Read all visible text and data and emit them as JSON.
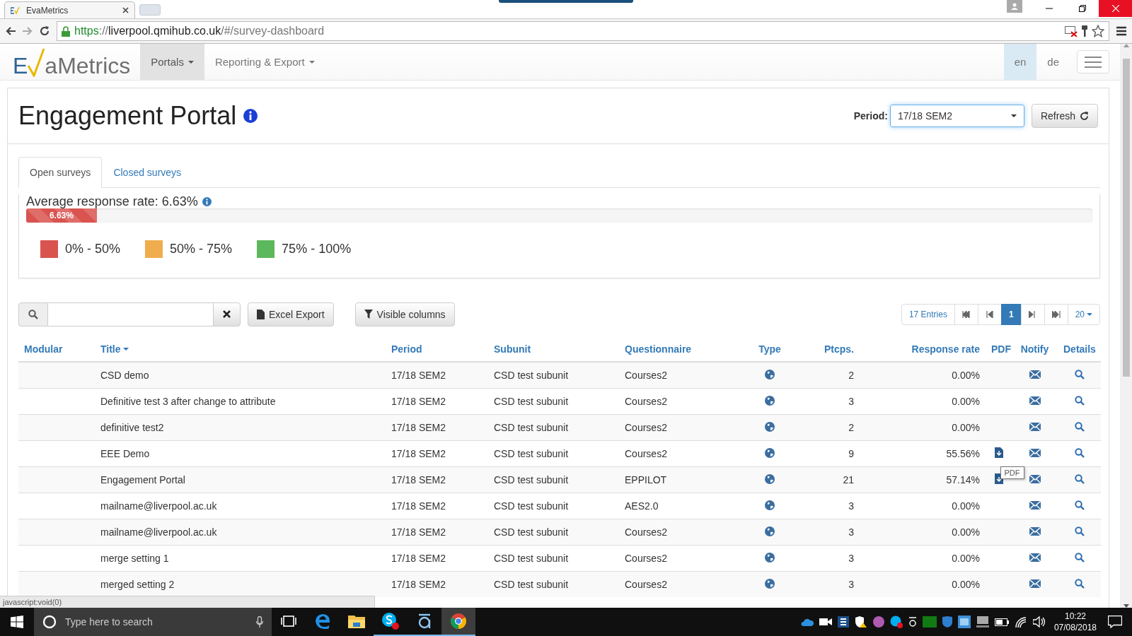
{
  "browser": {
    "tab_title": "EvaMetrics",
    "url": [
      {
        "text": "https",
        "kind": "scheme"
      },
      {
        "text": "://",
        "kind": "rest"
      },
      {
        "text": "liverpool.qmihub.co.uk",
        "kind": "host"
      },
      {
        "text": "/#/survey-dashboard",
        "kind": "rest"
      }
    ]
  },
  "navbar": {
    "logo": [
      "E",
      "aMetrics"
    ],
    "menus": [
      {
        "label": "Portals",
        "selected": true
      },
      {
        "label": "Reporting & Export",
        "selected": false
      }
    ],
    "languages": [
      {
        "label": "en",
        "selected": true
      },
      {
        "label": "de",
        "selected": false
      }
    ]
  },
  "header": {
    "title": "Engagement Portal",
    "period_label": "Period:",
    "period_value": "17/18 SEM2",
    "refresh": "Refresh"
  },
  "tabs": [
    {
      "label": "Open surveys",
      "selected": true
    },
    {
      "label": "Closed surveys",
      "selected": false
    }
  ],
  "summary": {
    "label": "Average response rate: 6.63%",
    "level": 0.0663,
    "bar_label": "6.63%",
    "legend": [
      {
        "label": "0% - 50%",
        "color": "#d9534f"
      },
      {
        "label": "50% - 75%",
        "color": "#f0ad4e"
      },
      {
        "label": "75% - 100%",
        "color": "#5cb85c"
      }
    ]
  },
  "toolbar": {
    "excel": "Excel Export",
    "columns": "Visible columns"
  },
  "pagination": {
    "entries": "17 Entries",
    "page": "1",
    "page_size": "20"
  },
  "table": {
    "columns": [
      {
        "label": "Modular",
        "sorted": false
      },
      {
        "label": "Title",
        "sorted": true
      },
      {
        "label": "Period",
        "sorted": false
      },
      {
        "label": "Subunit",
        "sorted": false
      },
      {
        "label": "Questionnaire",
        "sorted": false
      },
      {
        "label": "Type",
        "sorted": false
      },
      {
        "label": "Ptcps.",
        "sorted": false
      },
      {
        "label": "Response rate",
        "sorted": false
      },
      {
        "label": "PDF",
        "sorted": false
      },
      {
        "label": "Notify",
        "sorted": false
      },
      {
        "label": "Details",
        "sorted": false
      }
    ],
    "rows": [
      {
        "title": "CSD demo",
        "period": "17/18 SEM2",
        "subunit": "CSD test subunit",
        "questionnaire": "Courses2",
        "ptcps": "2",
        "rate": "0.00%",
        "pdf": false
      },
      {
        "title": "Definitive test 3 after change to attribute",
        "period": "17/18 SEM2",
        "subunit": "CSD test subunit",
        "questionnaire": "Courses2",
        "ptcps": "3",
        "rate": "0.00%",
        "pdf": false
      },
      {
        "title": "definitive test2",
        "period": "17/18 SEM2",
        "subunit": "CSD test subunit",
        "questionnaire": "Courses2",
        "ptcps": "2",
        "rate": "0.00%",
        "pdf": false
      },
      {
        "title": "EEE Demo",
        "period": "17/18 SEM2",
        "subunit": "CSD test subunit",
        "questionnaire": "Courses2",
        "ptcps": "9",
        "rate": "55.56%",
        "pdf": true
      },
      {
        "title": "Engagement Portal",
        "period": "17/18 SEM2",
        "subunit": "CSD test subunit",
        "questionnaire": "EPPILOT",
        "ptcps": "21",
        "rate": "57.14%",
        "pdf": true,
        "tooltip": "PDF"
      },
      {
        "title": "mailname@liverpool.ac.uk",
        "period": "17/18 SEM2",
        "subunit": "CSD test subunit",
        "questionnaire": "AES2.0",
        "ptcps": "3",
        "rate": "0.00%",
        "pdf": false
      },
      {
        "title": "mailname@liverpool.ac.uk",
        "period": "17/18 SEM2",
        "subunit": "CSD test subunit",
        "questionnaire": "Courses2",
        "ptcps": "3",
        "rate": "0.00%",
        "pdf": false
      },
      {
        "title": "merge setting 1",
        "period": "17/18 SEM2",
        "subunit": "CSD test subunit",
        "questionnaire": "Courses2",
        "ptcps": "3",
        "rate": "0.00%",
        "pdf": false
      },
      {
        "title": "merged setting 2",
        "period": "17/18 SEM2",
        "subunit": "CSD test subunit",
        "questionnaire": "Courses2",
        "ptcps": "3",
        "rate": "0.00%",
        "pdf": false
      }
    ]
  },
  "status_text": "javascript:void(0)",
  "taskbar": {
    "search_placeholder": "Type here to search",
    "apps": [
      {
        "kind": "task-view",
        "running": false,
        "selected": false
      },
      {
        "kind": "edge",
        "running": false,
        "selected": false
      },
      {
        "kind": "folder",
        "running": false,
        "selected": false
      },
      {
        "kind": "skype",
        "running": true,
        "selected": false
      },
      {
        "kind": "ring",
        "running": true,
        "selected": false
      },
      {
        "kind": "chrome",
        "running": true,
        "selected": true
      }
    ],
    "time": "10:22",
    "date": "07/08/2018"
  }
}
